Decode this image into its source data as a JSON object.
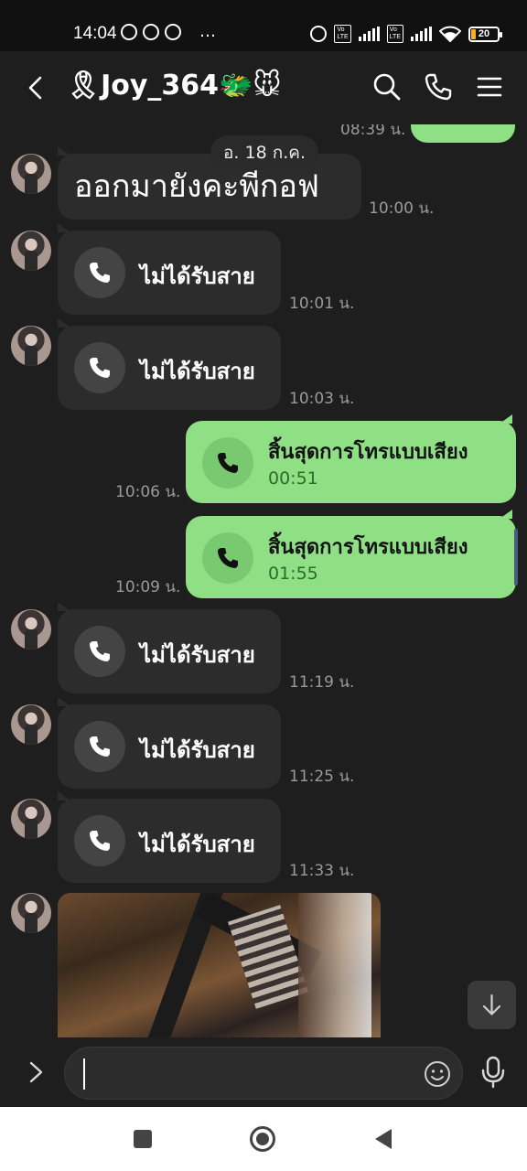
{
  "status_bar": {
    "time": "14:04",
    "overflow": "…",
    "battery": "20",
    "icons": [
      "alarm-icon",
      "volte-icon",
      "signal-icon",
      "volte-icon",
      "signal-icon",
      "wifi-icon",
      "battery-icon"
    ]
  },
  "header": {
    "title": "🎗Joy_364🐲🐭",
    "buttons": [
      "back-icon",
      "search-icon",
      "phone-icon",
      "menu-icon"
    ]
  },
  "chat": {
    "top_partial_time": "08:39 น.",
    "date_separator": "อ. 18 ก.ค.",
    "messages": [
      {
        "type": "text",
        "direction": "in",
        "text": "ออกมายังคะพี่กอฟ",
        "time": "10:00 น."
      },
      {
        "type": "missed_call",
        "direction": "in",
        "label": "ไม่ได้รับสาย",
        "time": "10:01 น."
      },
      {
        "type": "missed_call",
        "direction": "in",
        "label": "ไม่ได้รับสาย",
        "time": "10:03 น."
      },
      {
        "type": "call_ended",
        "direction": "out",
        "label": "สิ้นสุดการโทรแบบเสียง",
        "duration": "00:51",
        "time": "10:06 น."
      },
      {
        "type": "call_ended",
        "direction": "out",
        "label": "สิ้นสุดการโทรแบบเสียง",
        "duration": "01:55",
        "time": "10:09 น."
      },
      {
        "type": "missed_call",
        "direction": "in",
        "label": "ไม่ได้รับสาย",
        "time": "11:19 น."
      },
      {
        "type": "missed_call",
        "direction": "in",
        "label": "ไม่ได้รับสาย",
        "time": "11:25 น."
      },
      {
        "type": "missed_call",
        "direction": "in",
        "label": "ไม่ได้รับสาย",
        "time": "11:33 น."
      },
      {
        "type": "image",
        "direction": "in"
      }
    ]
  },
  "input_bar": {
    "value": "",
    "placeholder": ""
  },
  "colors": {
    "background": "#1e1e1e",
    "incoming_bubble": "#2c2c2c",
    "outgoing_bubble": "#8fdf85",
    "timestamp": "#9a9a9a"
  }
}
